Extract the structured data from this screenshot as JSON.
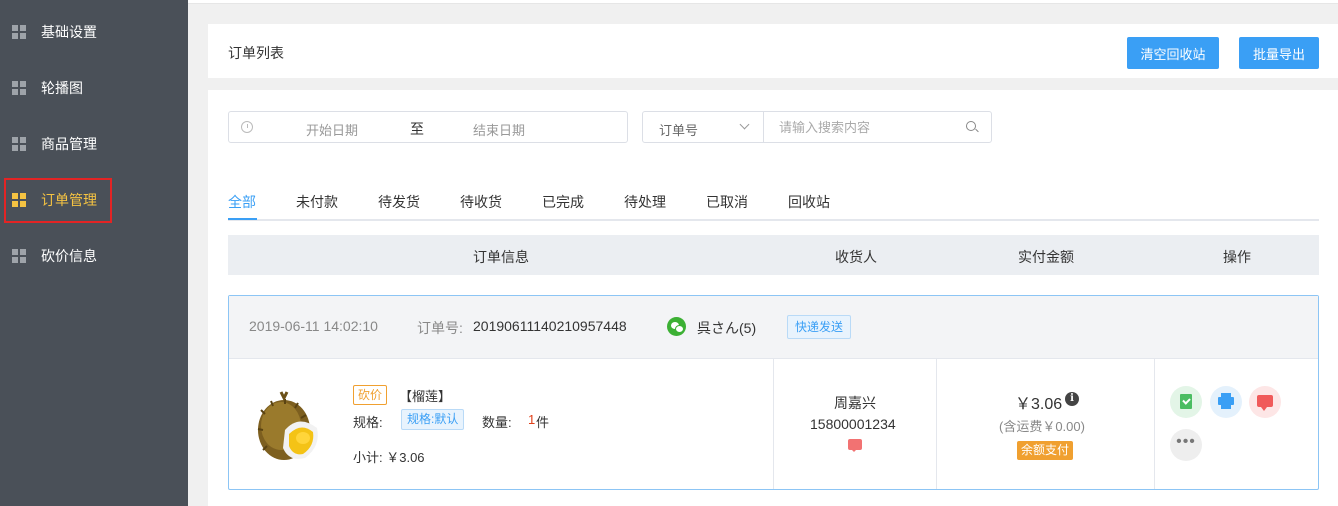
{
  "sidebar": {
    "items": [
      {
        "label": "基础设置",
        "icon": "grid-icon"
      },
      {
        "label": "轮播图",
        "icon": "grid-icon"
      },
      {
        "label": "商品管理",
        "icon": "grid-icon"
      },
      {
        "label": "订单管理",
        "icon": "grid-icon",
        "active": true
      },
      {
        "label": "砍价信息",
        "icon": "grid-icon"
      }
    ]
  },
  "header": {
    "title": "订单列表",
    "clear_recycle_label": "清空回收站",
    "batch_export_label": "批量导出"
  },
  "filters": {
    "start_date_placeholder": "开始日期",
    "separator": "至",
    "end_date_placeholder": "结束日期",
    "search_field_selected": "订单号",
    "search_placeholder": "请输入搜索内容"
  },
  "tabs": [
    "全部",
    "未付款",
    "待发货",
    "待收货",
    "已完成",
    "待处理",
    "已取消",
    "回收站"
  ],
  "table_headers": [
    "订单信息",
    "收货人",
    "实付金额",
    "操作"
  ],
  "order": {
    "datetime": "2019-06-11 14:02:10",
    "order_no_label": "订单号:",
    "order_no": "20190611140210957448",
    "user": "呉さん(5)",
    "delivery_badge": "快递发送",
    "product_tag": "砍价",
    "product_name": "【榴莲】",
    "spec_label": "规格:",
    "spec_value": "规格:默认",
    "qty_label": "数量:",
    "qty_value": "1",
    "qty_unit": "件",
    "subtotal": "小计:  ￥3.06",
    "receiver_name": "周嘉兴",
    "receiver_phone": "15800001234",
    "price": "￥3.06",
    "info_glyph": "i",
    "freight": "(含运费￥0.00)",
    "pay_method": "余额支付",
    "more_glyph": "•••"
  },
  "colors": {
    "sidebar_bg": "#4a5058",
    "active": "#f5c342",
    "primary": "#3a9ff5",
    "highlight_box": "#e32424"
  }
}
